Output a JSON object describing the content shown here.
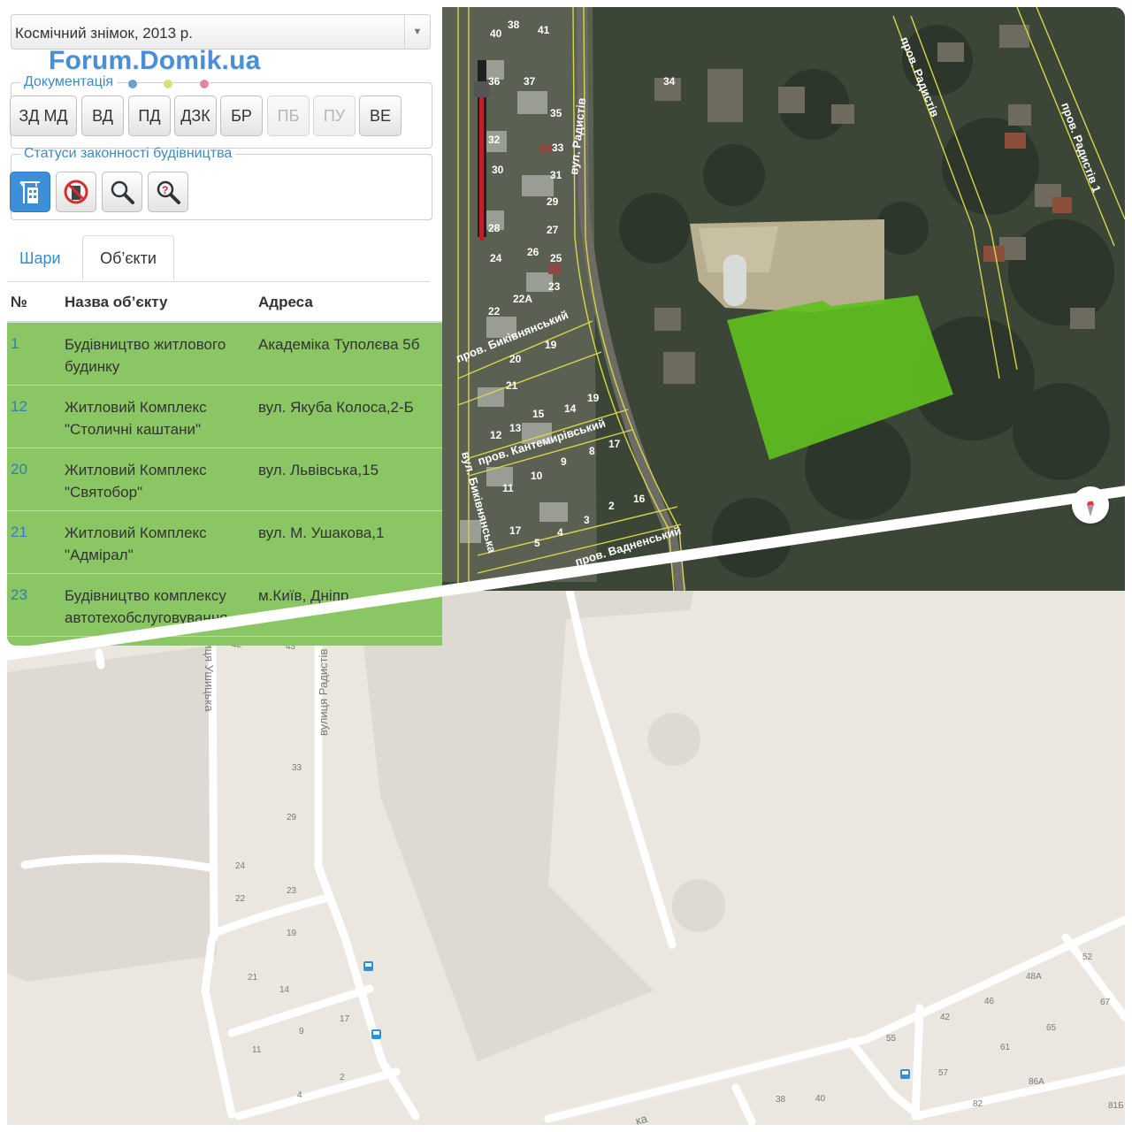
{
  "layer_select": {
    "value": "Космічний знімок, 2013 р."
  },
  "watermark": "Forum.Domik.ua",
  "documentation": {
    "legend": "Документація",
    "dot_colors": [
      "#6b9ed3",
      "#dcdc7a",
      "#e08aa0"
    ],
    "buttons": [
      {
        "label": "ЗД МД",
        "enabled": true
      },
      {
        "label": "ВД",
        "enabled": true
      },
      {
        "label": "ПД",
        "enabled": true
      },
      {
        "label": "ДЗК",
        "enabled": true
      },
      {
        "label": "БР",
        "enabled": true
      },
      {
        "label": "ПБ",
        "enabled": false
      },
      {
        "label": "ПУ",
        "enabled": false
      },
      {
        "label": "ВЕ",
        "enabled": true
      }
    ]
  },
  "statuses": {
    "legend": "Статуси законності будівництва",
    "buttons": [
      {
        "icon": "crane-building-icon",
        "active": true
      },
      {
        "icon": "prohibited-building-icon",
        "active": false
      },
      {
        "icon": "magnifier-icon",
        "active": false
      },
      {
        "icon": "magnifier-question-icon",
        "active": false
      }
    ]
  },
  "tabs": [
    {
      "label": "Шари",
      "active": false
    },
    {
      "label": "Об’єкти",
      "active": true
    }
  ],
  "table": {
    "headers": [
      "№",
      "Назва об’єкту",
      "Адреса"
    ],
    "rows": [
      {
        "num": "1",
        "name": "Будівництво житлового будинку",
        "addr": "Академіка Туполєва 5б"
      },
      {
        "num": "12",
        "name": "Житловий Комплекс \"Столичні каштани\"",
        "addr": "вул. Якуба Колоса,2-Б"
      },
      {
        "num": "20",
        "name": "Житловий Комплекс \"Святобор\"",
        "addr": "вул. Львівська,15"
      },
      {
        "num": "21",
        "name": "Житловий Комплекс \"Адмірал\"",
        "addr": "вул. М. Ушакова,1"
      },
      {
        "num": "23",
        "name": "Будівництво комплексу автотехобслуговування",
        "addr": "м.Київ, Дніпр"
      }
    ],
    "row_color": "#8bc664"
  },
  "satellite": {
    "street_labels": [
      "вул. Радистів",
      "пров. Радистів",
      "пров. Радистів 1",
      "пров. Биківнянський",
      "пров. Кантемирівський",
      "вул. Биківнянська",
      "пров. Вадненський"
    ],
    "house_numbers": [
      "38",
      "40",
      "41",
      "36",
      "37",
      "34",
      "35",
      "33",
      "32",
      "31",
      "30",
      "29",
      "28",
      "27",
      "26",
      "25",
      "24",
      "23",
      "22",
      "22А",
      "20",
      "19",
      "21",
      "19",
      "14",
      "15",
      "13",
      "12",
      "17",
      "8",
      "9",
      "10",
      "11",
      "16",
      "2",
      "3",
      "4",
      "5",
      "17"
    ],
    "highlight_color": "#5fbf1e"
  },
  "street_map": {
    "street_labels": [
      "вулиця Ушицька",
      "вулиця Радистів",
      "ка"
    ],
    "house_numbers": [
      "42",
      "43",
      "36",
      "33",
      "29",
      "24",
      "22",
      "23",
      "19",
      "21",
      "14",
      "9",
      "17",
      "11",
      "2",
      "4",
      "52",
      "48А",
      "46",
      "67",
      "42",
      "65",
      "61",
      "55",
      "86А",
      "57",
      "38",
      "40",
      "82",
      "81Б"
    ],
    "bus_stop_icon": "bus-stop-icon"
  },
  "compass_icon": "compass-icon"
}
